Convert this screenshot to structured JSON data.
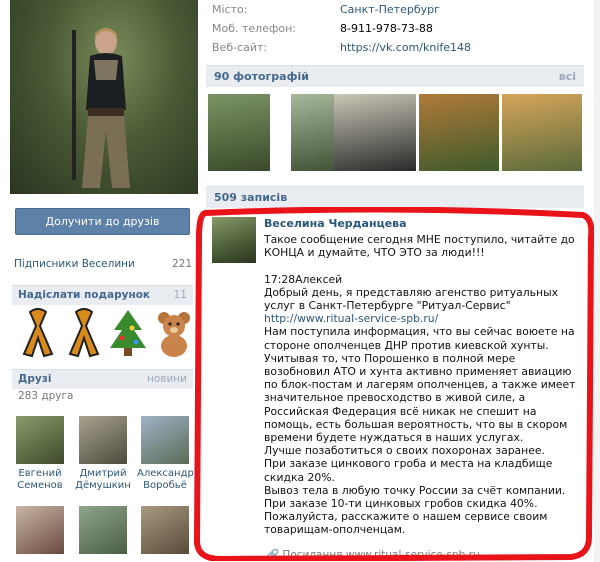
{
  "info": [
    {
      "label": "Місто:",
      "value": "Санкт-Петербург",
      "link": true
    },
    {
      "label": "Моб. телефон:",
      "value": "8-911-978-73-88",
      "link": false
    },
    {
      "label": "Веб-сайт:",
      "value": "https://vk.com/knife148",
      "link": true
    }
  ],
  "sidebar": {
    "add_friend": "Долучити до друзів",
    "subscribers_label": "Підписники Веселини",
    "subscribers_count": "221",
    "gifts_title": "Надіслати подарунок",
    "gifts_count": "11",
    "gifts": [
      "ribbon-icon",
      "ribbon-icon",
      "tree-icon",
      "bear-icon"
    ],
    "friends_title": "Друзі",
    "friends_right": "новини",
    "friends_count": "283 друга",
    "friends": [
      {
        "first": "Евгений",
        "last": "Семенов"
      },
      {
        "first": "Дмитрий",
        "last": "Дёмушкин"
      },
      {
        "first": "Александр",
        "last": "Воробьё"
      },
      {
        "first": "",
        "last": ""
      },
      {
        "first": "",
        "last": ""
      },
      {
        "first": "",
        "last": ""
      }
    ]
  },
  "photos": {
    "title": "90 фотографій",
    "right": "всі"
  },
  "wall": {
    "title": "509 записів",
    "author": "Веселина Черданцева",
    "intro": "Такое сообщение сегодня МНЕ поступило, читайте до КОНЦА и думайте, ЧТО ЭТО за люди!!!",
    "time_line": "17:28Алексей",
    "p1": "Добрый день, я представляю агенство ритуальных услуг в Санкт-Петербурге \"Ритуал-Сервис\"",
    "p1_link": "http://www.ritual-service-spb.ru/",
    "p2": "Нам поступила информация, что вы сейчас воюете на стороне ополченцев ДНР против киевской хунты.",
    "p3": "Учитывая то, что Порошенко в полной мере возобновил АТО и хунта активно применяет авиацию по блок-постам и лагерям ополченцев, а также имеет значительное превосходство в живой силе, а Российская Федерация всё никак не спешит на помощь, есть большая вероятность, что вы в скором времени будете нуждаться в наших услугах.",
    "p4": "Лучше позаботиться о своих похоронах заранее.",
    "p5": "При заказе цинкового гроба и места на кладбище скидка 20%.",
    "p6": "Вывоз тела в любую точку России за счёт компании.",
    "p7": "При заказе 10-ти цинковых гробов скидка 40%.",
    "p8": "Пожалуйста, расскажите о нашем сервисе своим товарищам-ополченцам.",
    "source": "Посилання www.ritual-service-spb.ru"
  }
}
